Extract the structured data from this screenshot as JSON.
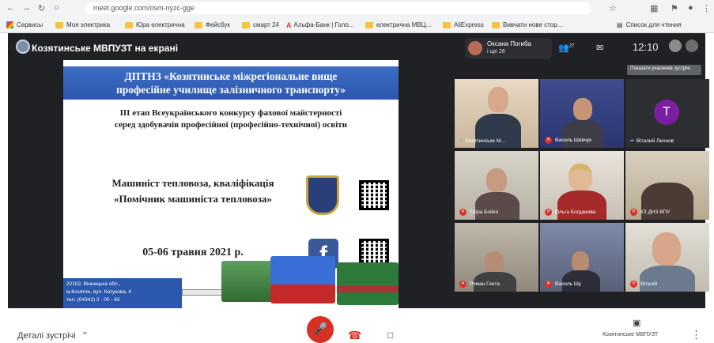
{
  "browser": {
    "url": "meet.google.com/osm-nyzc-gge",
    "bookmarks": [
      {
        "label": "Сервисы",
        "kind": "apps"
      },
      {
        "label": "Моя электрика",
        "kind": "folder"
      },
      {
        "label": "Юра електрична",
        "kind": "folder"
      },
      {
        "label": "Фейсбук",
        "kind": "folder"
      },
      {
        "label": "смарт 24",
        "kind": "folder"
      },
      {
        "label": "Альфа-Банк | Голо...",
        "kind": "alfa"
      },
      {
        "label": "електрична МВЦ...",
        "kind": "folder"
      },
      {
        "label": "AliExpress",
        "kind": "folder"
      },
      {
        "label": "Вивчати нове стор...",
        "kind": "folder"
      }
    ],
    "reading_list": "Список для чтения"
  },
  "meet": {
    "title": "Козятинське МВПУЗТ на екрані",
    "presenter_name": "Оксана Погиба",
    "presenter_sub": "і ще 26",
    "people_count": "27",
    "clock": "12:10",
    "tooltip": "Показати учасників зустрічі",
    "slide": {
      "banner_line1": "ДПТНЗ «Козятинське міжрегіональне вище",
      "banner_line2": "професійне училище залізничного транспорту»",
      "stage_line1": "ІІІ етап Всеукраїнського конкурсу фахової майстерності",
      "stage_line2": "серед здобувачів професійної (професійно-технічної) освіти",
      "qual_line1": "Машиніст тепловоза, кваліфікація",
      "qual_line2": "«Помічник машиніста тепловоза»",
      "dates": "05-06 травня 2021 р.",
      "fb_letter": "f",
      "address": [
        "22102, Вінницька обл.,",
        "м.Козятин, вул. Катукова, 4",
        "тел. (04342) 2 - 00 - 63"
      ]
    },
    "participants": [
      {
        "name": "Козятинське М...",
        "muted": false
      },
      {
        "name": "Василь Шевчук",
        "muted": true
      },
      {
        "name": "Віталий Леонов",
        "muted": false,
        "initial": "T"
      },
      {
        "name": "Таïра Бойко",
        "muted": true
      },
      {
        "name": "Ольга Богданова",
        "muted": true
      },
      {
        "name": "КЗ ДНЗ ВПУ",
        "muted": true
      },
      {
        "name": "Роман Гонта",
        "muted": true
      },
      {
        "name": "Василь Шу",
        "muted": true
      },
      {
        "name": "Віталій",
        "muted": true
      }
    ]
  },
  "controls": {
    "details": "Деталі зустрічі",
    "present_label": "Козятинське МВПУЗТ"
  }
}
